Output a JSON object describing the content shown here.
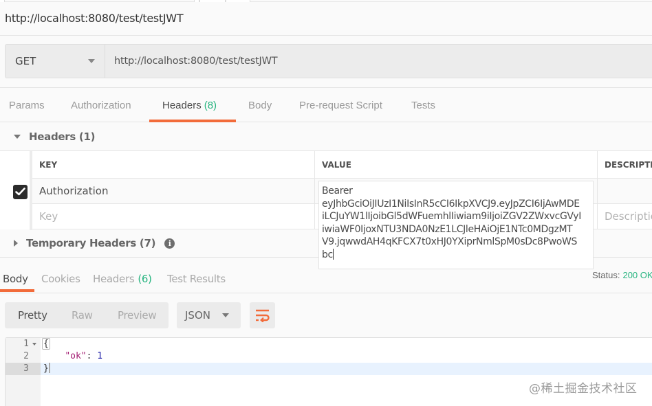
{
  "request": {
    "title": "http://localhost:8080/test/testJWT",
    "method": "GET",
    "url": "http://localhost:8080/test/testJWT"
  },
  "request_tabs": [
    {
      "label": "Params",
      "count": null,
      "active": false
    },
    {
      "label": "Authorization",
      "count": null,
      "active": false
    },
    {
      "label": "Headers",
      "count": "(8)",
      "active": true
    },
    {
      "label": "Body",
      "count": null,
      "active": false
    },
    {
      "label": "Pre-request Script",
      "count": null,
      "active": false
    },
    {
      "label": "Tests",
      "count": null,
      "active": false
    }
  ],
  "headers_section": {
    "title": "Headers (1)",
    "columns": {
      "key": "KEY",
      "value": "VALUE",
      "description": "DESCRIPTION"
    },
    "rows": [
      {
        "checked": true,
        "key": "Authorization",
        "value": "Bearer eyJhbGciOiJIUzI1NiIsInR5cCI6IkpXVCJ9.eyJpZCI6IjAwMDEiLCJuYW1lIjoibGl5dWFuemhlIiwiam9iIjoiZGV2ZWxvcGVyIiwiaWF0IjoxNTU3NDA0NzE1LCJleHAiOjE1NTc0MDgzMTV9.jqwwdAH4qKFCX7t0xHJ0YXiprNmlSpM0sDc8PwoWSbc",
        "description": ""
      }
    ],
    "new_row": {
      "key_placeholder": "Key",
      "description_placeholder": "Description"
    },
    "value_popup_lines": [
      "Bearer",
      "eyJhbGciOiJIUzI1NiIsInR5cCI6IkpXVCJ9.eyJpZCI6IjAwMDE",
      "iLCJuYW1lIjoibGl5dWFuemhlIiwiam9iIjoiZGV2ZWxvcGVyI",
      "iwiaWF0IjoxNTU3NDA0NzE1LCJleHAiOjE1NTc0MDgzMT",
      "V9.jqwwdAH4qKFCX7t0xHJ0YXiprNmlSpM0sDc8PwoWS",
      "bc"
    ]
  },
  "temporary_headers": {
    "title": "Temporary Headers (7)",
    "info_icon": "i"
  },
  "response_tabs": [
    {
      "label": "Body",
      "count": null,
      "active": true
    },
    {
      "label": "Cookies",
      "count": null,
      "active": false
    },
    {
      "label": "Headers",
      "count": "(6)",
      "active": false
    },
    {
      "label": "Test Results",
      "count": null,
      "active": false
    }
  ],
  "status": {
    "label": "Status:",
    "value": "200 OK",
    "color": "#26b47f"
  },
  "view_modes": [
    {
      "label": "Pretty",
      "active": true
    },
    {
      "label": "Raw",
      "active": false
    },
    {
      "label": "Preview",
      "active": false
    }
  ],
  "format_select": {
    "value": "JSON"
  },
  "accent_color": "#f26b3a",
  "response_body": {
    "line_numbers": [
      "1",
      "2",
      "3"
    ],
    "lines": {
      "open": "{",
      "key": "\"ok\"",
      "colon": ": ",
      "value": "1",
      "close": "}"
    }
  },
  "watermark": "@稀土掘金技术社区"
}
